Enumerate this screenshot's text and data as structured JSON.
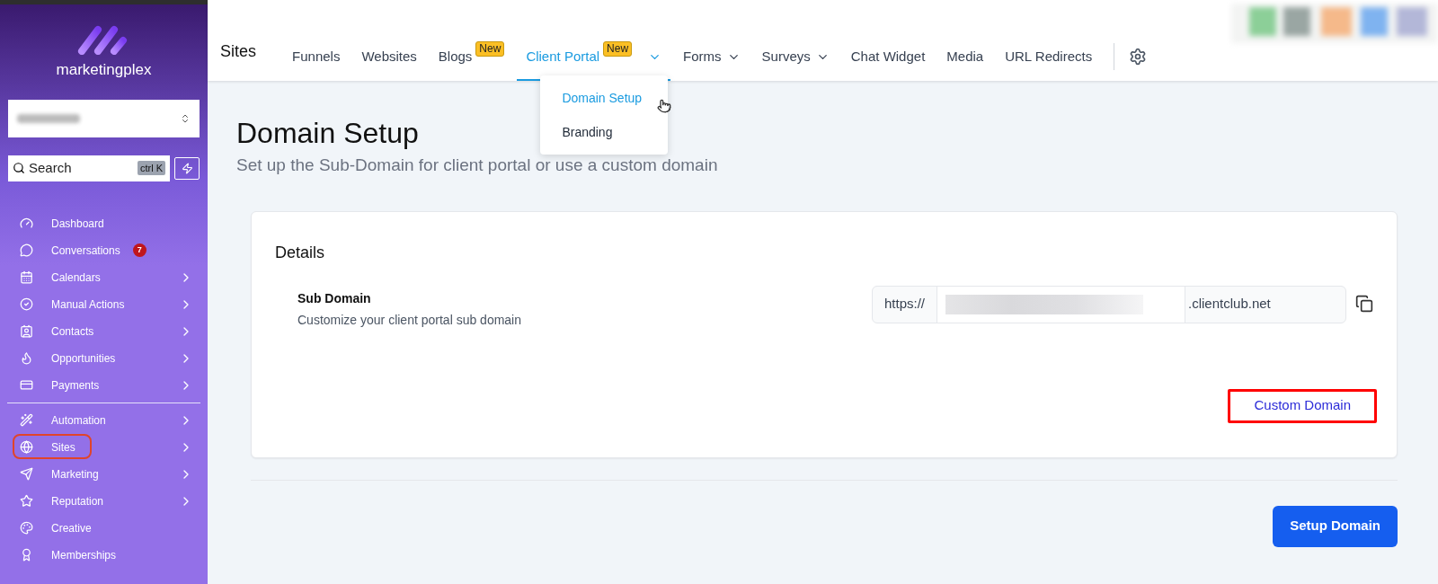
{
  "sidebar": {
    "brand": "marketingplex",
    "search": {
      "placeholder": "Search",
      "shortcut": "ctrl K"
    },
    "groups": [
      [
        {
          "label": "Dashboard",
          "has_submenu": false
        },
        {
          "label": "Conversations",
          "has_submenu": false,
          "badge": "7"
        },
        {
          "label": "Calendars",
          "has_submenu": true
        },
        {
          "label": "Manual Actions",
          "has_submenu": true
        },
        {
          "label": "Contacts",
          "has_submenu": true
        },
        {
          "label": "Opportunities",
          "has_submenu": true
        },
        {
          "label": "Payments",
          "has_submenu": true
        }
      ],
      [
        {
          "label": "Automation",
          "has_submenu": true,
          "highlighted": false
        },
        {
          "label": "Sites",
          "has_submenu": true,
          "highlighted": true
        },
        {
          "label": "Marketing",
          "has_submenu": true,
          "highlighted": false
        },
        {
          "label": "Reputation",
          "has_submenu": true,
          "highlighted": false
        },
        {
          "label": "Creative",
          "has_submenu": false,
          "highlighted": false
        },
        {
          "label": "Memberships",
          "has_submenu": false,
          "highlighted": false
        }
      ]
    ]
  },
  "topnav": {
    "title": "Sites",
    "tabs": [
      {
        "label": "Funnels",
        "selected": false,
        "has_dropdown": false
      },
      {
        "label": "Websites",
        "selected": false,
        "has_dropdown": false
      },
      {
        "label": "Blogs",
        "selected": false,
        "has_dropdown": false,
        "badge": "New"
      },
      {
        "label": "Client Portal",
        "selected": true,
        "has_dropdown": true,
        "badge": "New"
      },
      {
        "label": "Forms",
        "selected": false,
        "has_dropdown": true
      },
      {
        "label": "Surveys",
        "selected": false,
        "has_dropdown": true
      },
      {
        "label": "Chat Widget",
        "selected": false,
        "has_dropdown": false
      },
      {
        "label": "Media",
        "selected": false,
        "has_dropdown": false
      },
      {
        "label": "URL Redirects",
        "selected": false,
        "has_dropdown": false
      }
    ],
    "dropdown": [
      {
        "label": "Domain Setup",
        "selected": true
      },
      {
        "label": "Branding",
        "selected": false
      }
    ]
  },
  "page": {
    "title": "Domain Setup",
    "subtitle": "Set up the Sub-Domain for client portal or use a custom domain",
    "card": {
      "title": "Details",
      "field": {
        "label": "Sub Domain",
        "description": "Customize your client portal sub domain",
        "prefix": "https://",
        "suffix": ".clientclub.net"
      },
      "link": {
        "label": "Custom Domain",
        "highlighted": true
      }
    },
    "button": "Setup Domain"
  }
}
